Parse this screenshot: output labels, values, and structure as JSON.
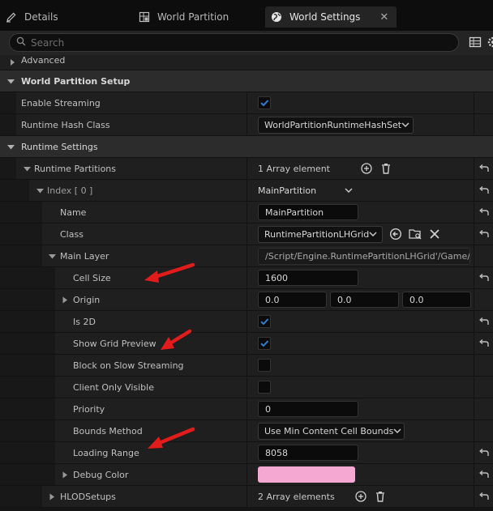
{
  "tabs": [
    {
      "label": "Details",
      "icon": "pencil-icon"
    },
    {
      "label": "World Partition",
      "icon": "grid-icon"
    },
    {
      "label": "World Settings",
      "icon": "globe-icon",
      "active": true,
      "close": "✕"
    }
  ],
  "search": {
    "placeholder": "Search"
  },
  "rows": {
    "advanced": {
      "label": "Advanced"
    },
    "wp_setup": {
      "label": "World Partition Setup"
    },
    "enable_streaming": {
      "label": "Enable Streaming"
    },
    "runtime_hash_class": {
      "label": "Runtime Hash Class",
      "value": "WorldPartitionRuntimeHashSet"
    },
    "runtime_settings": {
      "label": "Runtime Settings"
    },
    "runtime_partitions": {
      "label": "Runtime Partitions",
      "value": "1 Array element"
    },
    "index0": {
      "label": "Index [ 0 ]",
      "value": "MainPartition"
    },
    "name": {
      "label": "Name",
      "value": "MainPartition"
    },
    "class": {
      "label": "Class",
      "value": "RuntimePartitionLHGrid"
    },
    "main_layer": {
      "label": "Main Layer",
      "value": "/Script/Engine.RuntimePartitionLHGrid'/Game/W"
    },
    "cell_size": {
      "label": "Cell Size",
      "value": "1600"
    },
    "origin": {
      "label": "Origin",
      "x": "0.0",
      "y": "0.0",
      "z": "0.0"
    },
    "is2d": {
      "label": "Is 2D"
    },
    "show_grid_preview": {
      "label": "Show Grid Preview"
    },
    "block_on_slow": {
      "label": "Block on Slow Streaming"
    },
    "client_only": {
      "label": "Client Only Visible"
    },
    "priority": {
      "label": "Priority",
      "value": "0"
    },
    "bounds_method": {
      "label": "Bounds Method",
      "value": "Use Min Content Cell Bounds"
    },
    "loading_range": {
      "label": "Loading Range",
      "value": "8058"
    },
    "debug_color": {
      "label": "Debug Color",
      "color": "#f4a8d2"
    },
    "hlod_setups": {
      "label": "HLODSetups",
      "value": "2 Array elements"
    }
  },
  "colors": {
    "accent": "#2f7fd6",
    "annotation": "#e21b1b"
  }
}
